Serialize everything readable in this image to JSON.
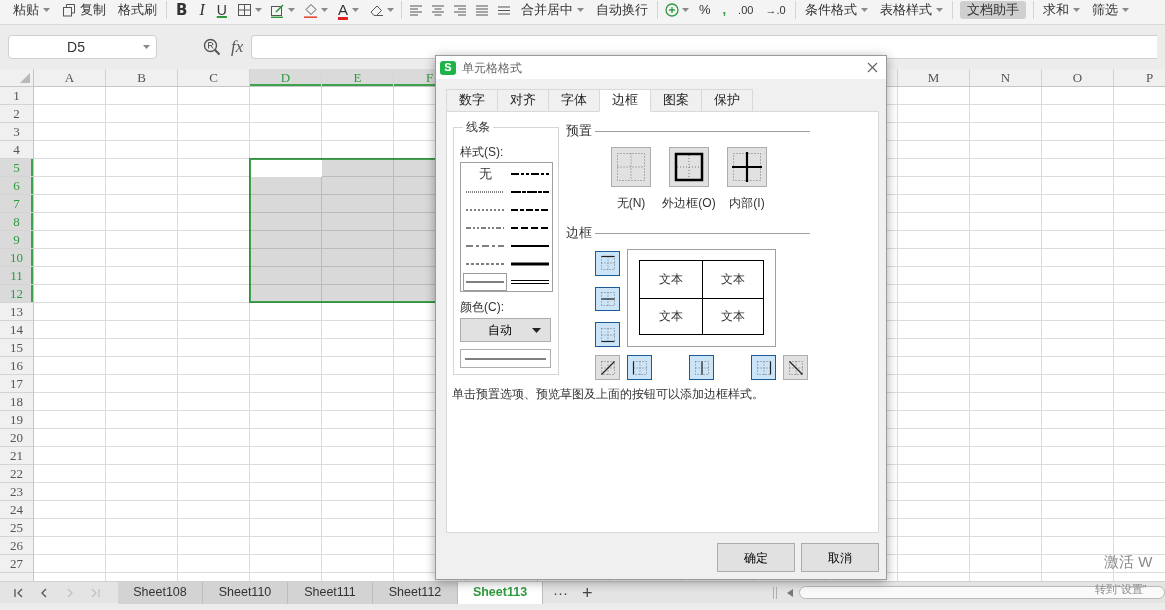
{
  "ribbon": {
    "paste": "粘贴",
    "copy": "复制",
    "format_painter": "格式刷",
    "bold": "B",
    "italic": "I",
    "underline": "U",
    "font_color": "A",
    "merge_center": "合并居中",
    "wrap_text": "自动换行",
    "percent": "%",
    "thousands": ",",
    "add_decimal": ".00",
    "remove_decimal": "→.0",
    "conditional_format": "条件格式",
    "table_style": "表格样式",
    "doc_assistant": {
      "label": "文档助手",
      "selected": true
    },
    "sum": "求和",
    "filter": "筛选"
  },
  "formula_bar": {
    "name_box": "D5",
    "function_label": "fx"
  },
  "sheet": {
    "columns_left": [
      {
        "label": "A",
        "selected": false,
        "active": false
      },
      {
        "label": "B",
        "selected": false,
        "active": false
      },
      {
        "label": "C",
        "selected": false,
        "active": false
      },
      {
        "label": "D",
        "selected": true,
        "active": true
      },
      {
        "label": "E",
        "selected": true,
        "active": false
      },
      {
        "label": "F",
        "selected": true,
        "active": false
      }
    ],
    "columns_right": [
      {
        "label": "M",
        "selected": false,
        "active": false
      },
      {
        "label": "N",
        "selected": false,
        "active": false
      },
      {
        "label": "O",
        "selected": false,
        "active": false
      },
      {
        "label": "P",
        "selected": false,
        "active": false
      }
    ],
    "rows": [
      {
        "label": "1",
        "selected": false,
        "active": false
      },
      {
        "label": "2",
        "selected": false,
        "active": false
      },
      {
        "label": "3",
        "selected": false,
        "active": false
      },
      {
        "label": "4",
        "selected": false,
        "active": false
      },
      {
        "label": "5",
        "selected": true,
        "active": true
      },
      {
        "label": "6",
        "selected": true,
        "active": false
      },
      {
        "label": "7",
        "selected": true,
        "active": false
      },
      {
        "label": "8",
        "selected": true,
        "active": false
      },
      {
        "label": "9",
        "selected": true,
        "active": false
      },
      {
        "label": "10",
        "selected": true,
        "active": false
      },
      {
        "label": "11",
        "selected": true,
        "active": false
      },
      {
        "label": "12",
        "selected": true,
        "active": false
      },
      {
        "label": "13",
        "selected": false,
        "active": false
      },
      {
        "label": "14",
        "selected": false,
        "active": false
      },
      {
        "label": "15",
        "selected": false,
        "active": false
      },
      {
        "label": "16",
        "selected": false,
        "active": false
      },
      {
        "label": "17",
        "selected": false,
        "active": false
      },
      {
        "label": "18",
        "selected": false,
        "active": false
      },
      {
        "label": "19",
        "selected": false,
        "active": false
      },
      {
        "label": "20",
        "selected": false,
        "active": false
      },
      {
        "label": "21",
        "selected": false,
        "active": false
      },
      {
        "label": "22",
        "selected": false,
        "active": false
      },
      {
        "label": "23",
        "selected": false,
        "active": false
      },
      {
        "label": "24",
        "selected": false,
        "active": false
      },
      {
        "label": "25",
        "selected": false,
        "active": false
      },
      {
        "label": "26",
        "selected": false,
        "active": false
      },
      {
        "label": "27",
        "selected": false,
        "active": false
      }
    ]
  },
  "dialog": {
    "app_logo": "S",
    "title": "单元格格式",
    "tabs": [
      {
        "label": "数字",
        "selected": false
      },
      {
        "label": "对齐",
        "selected": false
      },
      {
        "label": "字体",
        "selected": false
      },
      {
        "label": "边框",
        "selected": true
      },
      {
        "label": "图案",
        "selected": false
      },
      {
        "label": "保护",
        "selected": false
      }
    ],
    "line_group": {
      "title": "线条",
      "style_label": "样式(S):",
      "styles": [
        {
          "kind": "none",
          "label": "无",
          "selected": false
        },
        {
          "kind": "hair",
          "selected": false
        },
        {
          "kind": "dotted",
          "selected": false
        },
        {
          "kind": "dash-dot-dot",
          "selected": false
        },
        {
          "kind": "dash-dot",
          "selected": false
        },
        {
          "kind": "dashed",
          "selected": false
        },
        {
          "kind": "thin",
          "selected": true
        },
        {
          "kind": "medium-dash-dot-dot",
          "selected": false
        },
        {
          "kind": "slant-dash-dot",
          "selected": false
        },
        {
          "kind": "medium-dash-dot",
          "selected": false
        },
        {
          "kind": "medium-dashed",
          "selected": false
        },
        {
          "kind": "medium",
          "selected": false
        },
        {
          "kind": "thick",
          "selected": false
        },
        {
          "kind": "double",
          "selected": false
        }
      ],
      "color_label": "颜色(C):",
      "color_value": "自动"
    },
    "presets": {
      "title": "预置",
      "items": [
        {
          "kind": "none",
          "label": "无(N)"
        },
        {
          "kind": "outline",
          "label": "外边框(O)"
        },
        {
          "kind": "inside",
          "label": "内部(I)"
        }
      ]
    },
    "border": {
      "title": "边框",
      "side_buttons": [
        {
          "kind": "top",
          "selected": true
        },
        {
          "kind": "middle",
          "selected": true
        },
        {
          "kind": "bottom",
          "selected": true
        }
      ],
      "bottom_buttons": [
        {
          "kind": "diagonal-up",
          "selected": false
        },
        {
          "kind": "left",
          "selected": true
        },
        {
          "kind": "center",
          "selected": true
        },
        {
          "kind": "right",
          "selected": true
        },
        {
          "kind": "diagonal-down",
          "selected": false
        }
      ],
      "preview_texts": [
        "文本",
        "文本",
        "文本",
        "文本"
      ]
    },
    "hint": "单击预置选项、预览草图及上面的按钮可以添加边框样式。",
    "buttons": [
      "确定",
      "取消"
    ]
  },
  "sheet_tabs": {
    "nav": [
      {
        "kind": "first",
        "disabled": false
      },
      {
        "kind": "previous",
        "disabled": false
      },
      {
        "kind": "next",
        "disabled": true
      },
      {
        "kind": "last",
        "disabled": true
      }
    ],
    "tabs": [
      {
        "label": "Sheet108",
        "selected": false
      },
      {
        "label": "Sheet110",
        "selected": false
      },
      {
        "label": "Sheet111",
        "selected": false
      },
      {
        "label": "Sheet112",
        "selected": false
      },
      {
        "label": "Sheet113",
        "selected": true
      }
    ],
    "more": "···",
    "add": "+"
  },
  "os_notice": [
    "激活 W",
    "转到“设置”"
  ]
}
